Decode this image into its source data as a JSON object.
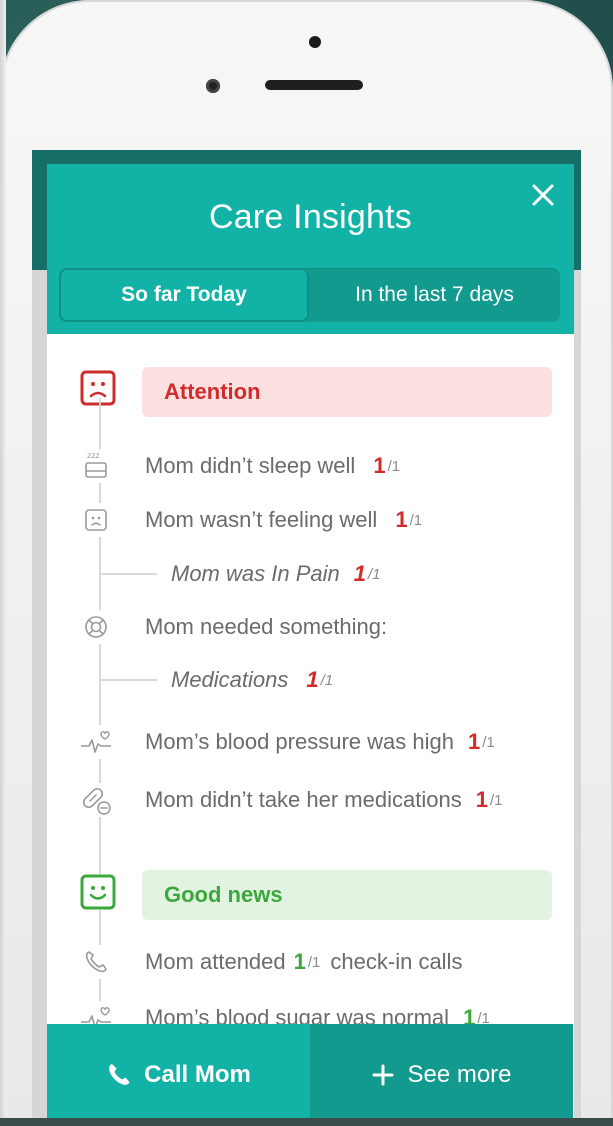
{
  "modal": {
    "title": "Care Insights",
    "close_icon": "close-icon",
    "tabs": [
      {
        "label": "So far Today",
        "active": true
      },
      {
        "label": "In the last 7 days",
        "active": false
      }
    ]
  },
  "sections": {
    "attention": {
      "label": "Attention",
      "icon": "sad-face-icon",
      "color": "#d12b2b",
      "items": [
        {
          "icon": "sleep-icon",
          "text": "Mom didn’t sleep well",
          "count": "1",
          "denom": "/1"
        },
        {
          "icon": "sad-face-small-icon",
          "text": "Mom wasn’t feeling well",
          "count": "1",
          "denom": "/1"
        },
        {
          "sub": true,
          "text": "Mom was In Pain",
          "count": "1",
          "denom": "/1"
        },
        {
          "icon": "lifebuoy-icon",
          "text": "Mom needed something:",
          "count": "",
          "denom": ""
        },
        {
          "sub": true,
          "text": "Medications",
          "count": "1",
          "denom": "/1"
        },
        {
          "icon": "heart-pulse-icon",
          "text": "Mom’s blood pressure was high",
          "count": "1",
          "denom": "/1"
        },
        {
          "icon": "pill-icon",
          "text": "Mom didn’t take her medications",
          "count": "1",
          "denom": "/1"
        }
      ]
    },
    "good_news": {
      "label": "Good news",
      "icon": "happy-face-icon",
      "color": "#3aa83a",
      "items": [
        {
          "icon": "phone-icon",
          "text_before": "Mom attended",
          "count": "1",
          "denom": "/1",
          "text_after": "check-in calls"
        },
        {
          "icon": "heart-pulse-icon",
          "text": "Mom’s blood sugar was normal",
          "count": "1",
          "denom": "/1"
        }
      ]
    }
  },
  "footer": {
    "call_label": "Call Mom",
    "see_more_label": "See more"
  },
  "colors": {
    "teal": "#12b3a6",
    "teal_dark": "#129a8f",
    "attention_bg": "#fde1e1",
    "good_bg": "#e2f3e1"
  }
}
